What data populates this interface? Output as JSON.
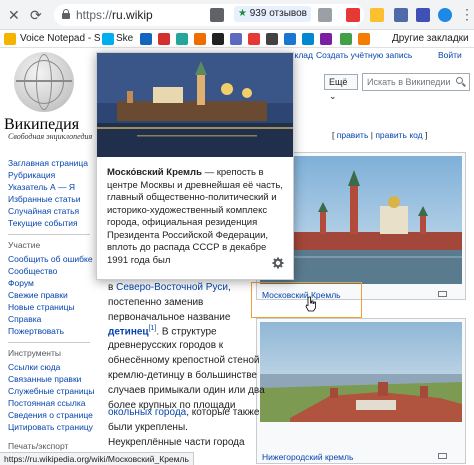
{
  "browser": {
    "url_prefix": "https://",
    "url_domain": "ru.wikip",
    "reviews_text": "939 отзывов",
    "reviews_star": "★",
    "bookmarks": [
      "Voice Notepad - S",
      "Ske"
    ],
    "other_bookmarks": "Другие закладки",
    "status_url": "https://ru.wikipedia.org/wiki/Московский_Кремль"
  },
  "wiki": {
    "logo_title": "Википедия",
    "logo_subtitle": "Свободная энциклопедия",
    "header_links": [
      "вклад",
      "Создать учётную запись",
      "Войти"
    ],
    "more_label": "Ещё",
    "search_placeholder": "Искать в Википедии",
    "edit_links": {
      "edit": "править",
      "sep": " | ",
      "edit_code": "править код",
      "open": "[ ",
      "close": " ]"
    },
    "sidebar": {
      "nav": [
        "Заглавная страница",
        "Рубрикация",
        "Указатель А — Я",
        "Избранные статьи",
        "Случайная статья",
        "Текущие события"
      ],
      "participation_head": "Участие",
      "participation": [
        "Сообщить об ошибке",
        "Сообщество",
        "Форум",
        "Свежие правки",
        "Новые страницы",
        "Справка",
        "Пожертвовать"
      ],
      "tools_head": "Инструменты",
      "tools": [
        "Ссылки сюда",
        "Связанные правки",
        "Служебные страницы",
        "Постоянная ссылка",
        "Сведения о странице",
        "Цитировать страницу"
      ],
      "print_head": "Печать/экспорт"
    },
    "body_lines": [
      {
        "pre": "в ",
        "link": "Северо-Восточной Руси",
        "post": ","
      },
      {
        "text": "постепенно заменив"
      },
      {
        "text": "первоначальное название"
      },
      {
        "bold_link": "детинец",
        "sup": "[1]",
        "post": ". В структуре"
      },
      {
        "text": "древнерусских городов к"
      },
      {
        "text": "обнесённому крепостной стеной"
      },
      {
        "text": "кремлю-детинцу в большинстве"
      },
      {
        "text": "случаев примыкали один или два"
      },
      {
        "text": "более крупных по площади"
      },
      {
        "link": "окольных города",
        "post": ", которые также"
      },
      {
        "text": "были укреплены."
      },
      {
        "text": "Неукреплённые части города"
      }
    ],
    "thumb1_caption": "Московский Кремль",
    "thumb2_caption": "Нижегородский кремль"
  },
  "popup": {
    "title": "Моско́вский Кремль",
    "text": " — крепость в центре Москвы и древнейшая её часть, главный общественно-политический и историко-художественный комплекс города, официальная резиденция Президента Российской Федерации, вплоть до распада СССР в декабре 1991 года был"
  },
  "colors": {
    "link": "#0645ad",
    "highlight": "#f0a030"
  }
}
